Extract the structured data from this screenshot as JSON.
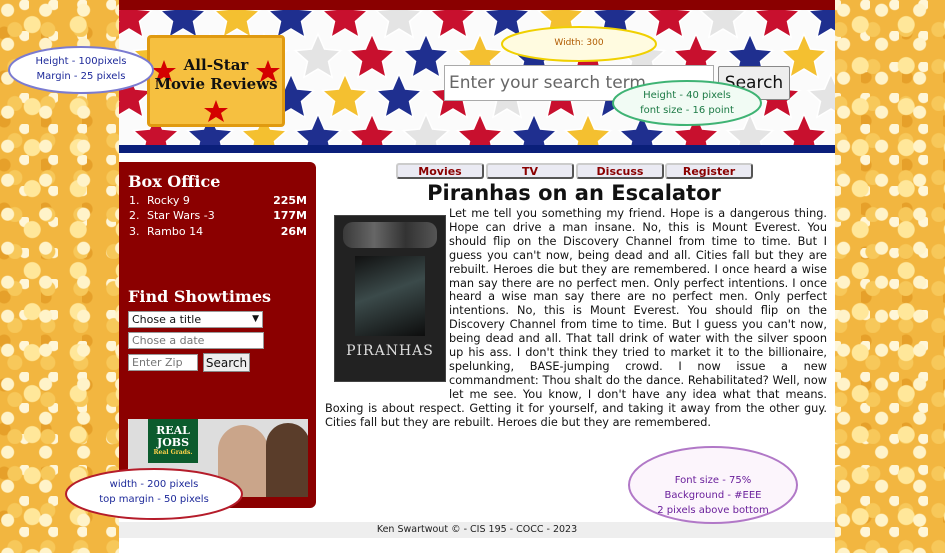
{
  "site": {
    "logo_lines": [
      "All-Star",
      "Movie Reviews"
    ]
  },
  "search": {
    "placeholder": "Enter your search term",
    "button_label": "Search"
  },
  "sidebar": {
    "box_office_heading": "Box Office",
    "box_office": [
      {
        "rank": "1.",
        "title": "Rocky 9",
        "gross": "225M"
      },
      {
        "rank": "2.",
        "title": "Star Wars -3",
        "gross": "177M"
      },
      {
        "rank": "3.",
        "title": "Rambo 14",
        "gross": "26M"
      }
    ],
    "showtimes_heading": "Find Showtimes",
    "title_select_value": "Chose a title",
    "date_placeholder": "Chose a date",
    "zip_placeholder": "Enter Zip",
    "search_button_label": "Search",
    "ad_text": [
      "REAL",
      "JOBS",
      "Real Grads."
    ]
  },
  "nav": {
    "items": [
      "Movies",
      "TV",
      "Discuss",
      "Register"
    ]
  },
  "main": {
    "title": "Piranhas on an Escalator",
    "poster_title": "PIRANHAS",
    "body": "Let me tell you something my friend. Hope is a dangerous thing. Hope can drive a man insane. No, this is Mount Everest. You should flip on the Discovery Channel from time to time. But I guess you can't now, being dead and all. Cities fall but they are rebuilt. Heroes die but they are remembered. I once heard a wise man say there are no perfect men. Only perfect intentions. I once heard a wise man say there are no perfect men. Only perfect intentions. No, this is Mount Everest. You should flip on the Discovery Channel from time to time. But I guess you can't now, being dead and all. That tall drink of water with the silver spoon up his ass. I don't think they tried to market it to the billionaire, spelunking, BASE-jumping crowd. I now issue a new commandment: Thou shalt do the dance. Rehabilitated? Well, now let me see. You know, I don't have any idea what that means. Boxing is about respect. Getting it for yourself, and taking it away from the other guy. Cities fall but they are rebuilt. Heroes die but they are remembered."
  },
  "footer": {
    "text": "Ken Swartwout © - CIS 195 - COCC - 2023"
  },
  "annotations": {
    "header_note": [
      "Height - 100pixels",
      "Margin - 25 pixels"
    ],
    "search_width_note": [
      "Width: 300"
    ],
    "search_height_note": [
      "Height - 40 pixels",
      "font size - 16 point"
    ],
    "sidebar_note": [
      "width - 200 pixels",
      "top margin - 50 pixels"
    ],
    "footer_note": [
      "Font size - 75%",
      "Background - #EEE",
      "2 pixels above bottom"
    ]
  },
  "colors": {
    "brand_red": "#8b0000",
    "banner_blue": "#0a1f7a",
    "footer_bg": "#EEE",
    "logo_gold": "#f6c040"
  }
}
